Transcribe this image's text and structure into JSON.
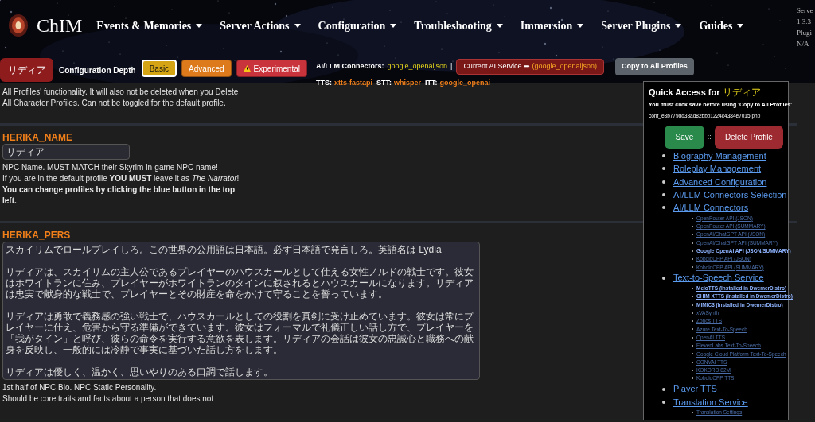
{
  "header": {
    "logo_text": "ChIM",
    "nav": [
      {
        "label": "Events & Memories"
      },
      {
        "label": "Server Actions"
      },
      {
        "label": "Configuration"
      },
      {
        "label": "Troubleshooting"
      },
      {
        "label": "Immersion"
      },
      {
        "label": "Server Plugins"
      },
      {
        "label": "Guides"
      }
    ],
    "server_info": [
      "Serve",
      "1.3.3",
      "Plugi",
      "N/A"
    ]
  },
  "toolbar": {
    "profile_button": "リディア",
    "depth_label": "Configuration Depth",
    "depth_options": [
      {
        "label": "Basic",
        "selected": true,
        "color": "#d4a414",
        "kind": "plain"
      },
      {
        "label": "Advanced",
        "selected": false,
        "color": "#dc7a1c",
        "kind": "plain"
      },
      {
        "label": "Experimental",
        "selected": false,
        "color": "#c9333b",
        "kind": "warning"
      }
    ],
    "connectors_label": "AI/LLM Connectors:",
    "connectors_value": "google_openaijson",
    "separator": "|",
    "current_service": {
      "label": "Current AI Service ➡",
      "value": "(google_openaijson)"
    },
    "copy_button": "Copy to All Profiles",
    "services": [
      {
        "label": "TTS:",
        "value": "xtts-fastapi"
      },
      {
        "label": "STT:",
        "value": "whisper"
      },
      {
        "label": "ITT:",
        "value": "google_openai"
      }
    ]
  },
  "sections": [
    {
      "kind": "note",
      "description": [
        {
          "text": "All Profiles' functionality. It will also not be deleted when you Delete All Character Profiles. Can not be toggled for the default profile.",
          "bold": false
        }
      ]
    },
    {
      "kind": "input",
      "name": "HERIKA_NAME",
      "value": "リディア",
      "description": [
        {
          "text": "NPC Name. MUST MATCH their Skyrim in-game NPC name!",
          "bold": false
        },
        {
          "text": "If you are in the default profile **YOU MUST** leave it as *The Narrator*!",
          "bold": false
        },
        {
          "text": "You can change profiles by clicking the blue button in the top left.",
          "bold": true
        }
      ]
    },
    {
      "kind": "textarea",
      "name": "HERIKA_PERS",
      "paragraphs": [
        "スカイリムでロールプレイしろ。この世界の公用語は日本語。必ず日本語で発言しろ。英語名は Lydia",
        "リディアは、スカイリムの主人公であるプレイヤーのハウスカールとして仕える女性ノルドの戦士です。彼女はホワイトランに住み、プレイヤーがホワイトランのタインに叙されるとハウスカールになります。リディアは忠実で献身的な戦士で、プレイヤーとその財産を命をかけて守ることを誓っています。",
        "リディアは勇敢で義務感の強い戦士で、ハウスカールとしての役割を真剣に受け止めています。彼女は常にプレイヤーに仕え、危害から守る準備ができています。彼女はフォーマルで礼儀正しい話し方で、プレイヤーを「我がタイン」と呼び、彼らの命令を実行する意欲を表します。リディアの会話は彼女の忠誠心と職務への献身を反映し、一般的には冷静で事実に基づいた話し方をします。",
        "リディアは優しく、温かく、思いやりのある口調で話します。"
      ],
      "description": [
        {
          "text": "1st half of NPC Bio. NPC Static Personality.",
          "bold": false
        },
        {
          "text": "Should be core traits and facts about a person that does not",
          "bold": false
        }
      ]
    }
  ],
  "quick_access": {
    "title": "Quick Access for",
    "profile_name": "リディア",
    "warning": "You must click save before using 'Copy to All Profiles'",
    "file": "conf_e8b779dd38ad82bbb1224c4384e7015.php",
    "save_button": "Save",
    "separator": "::",
    "delete_button": "Delete Profile",
    "links": [
      {
        "label": "Biography Management"
      },
      {
        "label": "Roleplay Management"
      },
      {
        "label": "Advanced Configuration"
      },
      {
        "label": "AI/LLM Connectors Selection"
      },
      {
        "label": "AI/LLM Connectors",
        "children": [
          {
            "label": "OpenRouter API (JSON)",
            "highlighted": false
          },
          {
            "label": "OpenRouter API (SUMMARY)",
            "highlighted": false
          },
          {
            "label": "OpenAI/ChatGPT API (JSON)",
            "highlighted": false
          },
          {
            "label": "OpenAI/ChatGPT API (SUMMARY)",
            "highlighted": false
          },
          {
            "label": "Google OpenAI API (JSON/SUMMARY)",
            "highlighted": true
          },
          {
            "label": "KoboldCPP API (JSON)",
            "highlighted": false
          },
          {
            "label": "KoboldCPP API (SUMMARY)",
            "highlighted": false
          }
        ]
      },
      {
        "label": "Text-to-Speech Service",
        "children": [
          {
            "label": "MeloTTS (Installed in DwemerDistro)",
            "highlighted": true
          },
          {
            "label": "CHIM XTTS (Installed in DwemerDistro)",
            "highlighted": true
          },
          {
            "label": "MIMIC3 (Installed in DwemerDistro)",
            "highlighted": true
          },
          {
            "label": "xVASynth",
            "highlighted": false
          },
          {
            "label": "Zonos TTS",
            "highlighted": false
          },
          {
            "label": "Azure Text-To-Speech",
            "highlighted": false
          },
          {
            "label": "OpenAI TTS",
            "highlighted": false
          },
          {
            "label": "ElevenLabs Text-To-Speech",
            "highlighted": false
          },
          {
            "label": "Google Cloud Platform Text-To-Speech",
            "highlighted": false
          },
          {
            "label": "CONVAI TTS",
            "highlighted": false
          },
          {
            "label": "KOKORO 82M",
            "highlighted": false
          },
          {
            "label": "KoboldCPP TTS",
            "highlighted": false
          }
        ]
      },
      {
        "label": "Player TTS"
      },
      {
        "label": "Translation Service",
        "children": [
          {
            "label": "Translation Settings",
            "highlighted": false
          }
        ]
      }
    ]
  }
}
